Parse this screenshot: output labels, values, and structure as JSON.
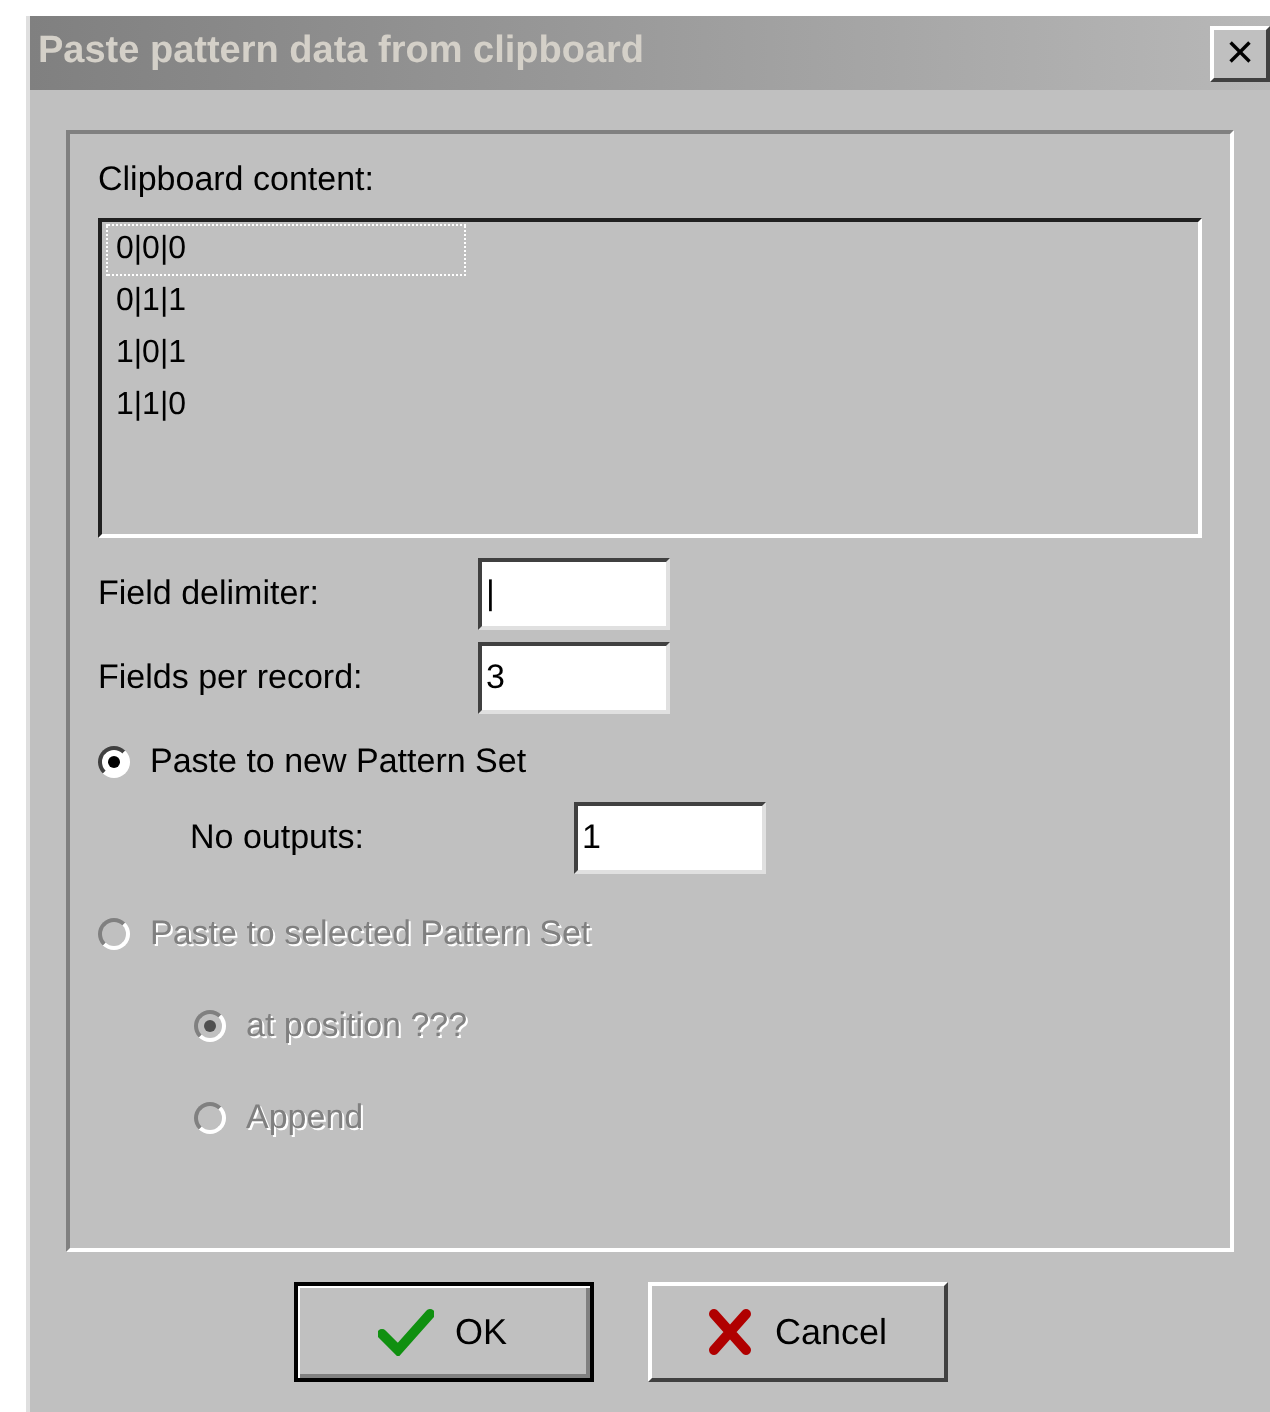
{
  "window": {
    "title": "Paste pattern data from clipboard",
    "close": "×"
  },
  "clipboard": {
    "label": "Clipboard content:",
    "lines": [
      {
        "text": "0|0|0",
        "focused": true
      },
      {
        "text": "0|1|1",
        "focused": false
      },
      {
        "text": "1|0|1",
        "focused": false
      },
      {
        "text": "1|1|0",
        "focused": false
      }
    ]
  },
  "fields": [
    {
      "label": "Field delimiter:",
      "value": "|"
    },
    {
      "label": "Fields per record:",
      "value": "3"
    }
  ],
  "paste_modes": [
    {
      "label": "Paste to new Pattern Set",
      "selected": true,
      "disabled": false,
      "field": {
        "label": "No outputs:",
        "value": "1"
      }
    },
    {
      "label": "Paste to selected Pattern Set",
      "selected": false,
      "disabled": true,
      "children": [
        {
          "label": "at position ???",
          "selected": true,
          "disabled": true
        },
        {
          "label": "Append",
          "selected": false,
          "disabled": true
        }
      ]
    }
  ],
  "buttons": [
    {
      "kind": "ok",
      "label": "OK"
    },
    {
      "kind": "cancel",
      "label": "Cancel"
    }
  ]
}
